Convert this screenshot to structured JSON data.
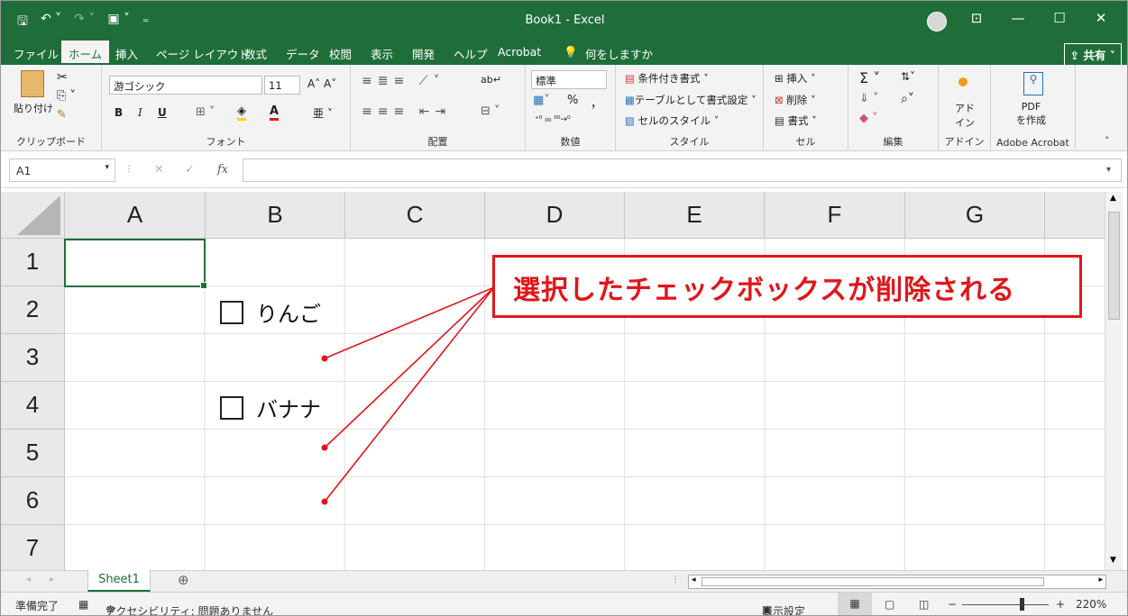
{
  "window": {
    "title": "Book1  -  Excel",
    "controls": [
      "ribbon-display-icon",
      "minimize-icon",
      "maximize-icon",
      "close-icon"
    ],
    "control_glyphs": [
      "⊡",
      "—",
      "☐",
      "✕"
    ]
  },
  "qat": {
    "save_glyph": "🖫",
    "undo_glyph": "↶ ˅",
    "redo_glyph": "↷ ˅",
    "print_glyph": "▣ ˅",
    "more_glyph": "₌"
  },
  "tabs": [
    "ファイル",
    "ホーム",
    "挿入",
    "ページ レイアウト",
    "数式",
    "データ",
    "校閲",
    "表示",
    "開発",
    "ヘルプ",
    "Acrobat",
    "何をしますか"
  ],
  "share_label": "共有",
  "ribbon": {
    "clipboard": {
      "paste_label": "貼り付け",
      "group_label": "クリップボード"
    },
    "font": {
      "font_name": "游ゴシック",
      "font_size": "11",
      "bold": "B",
      "italic": "I",
      "underline": "U",
      "group_label": "フォント"
    },
    "alignment": {
      "group_label": "配置"
    },
    "number": {
      "format": "標準",
      "percent": "%",
      "comma": "，",
      "group_label": "数値"
    },
    "styles": {
      "conditional": "条件付き書式",
      "as_table": "テーブルとして書式設定",
      "cell_styles": "セルのスタイル",
      "group_label": "スタイル"
    },
    "cells": {
      "insert": "挿入",
      "delete": "削除",
      "format": "書式",
      "group_label": "セル"
    },
    "editing": {
      "group_label": "編集"
    },
    "addins": {
      "label": "アド\nイン",
      "group_label": "アドイン"
    },
    "acrobat": {
      "label": "PDF\nを作成",
      "group_label": "Adobe Acrobat"
    }
  },
  "formula_bar": {
    "name_box": "A1",
    "fx": "fx",
    "cancel": "✕",
    "confirm": "✓",
    "value": ""
  },
  "columns": [
    "A",
    "B",
    "C",
    "D",
    "E",
    "F",
    "G"
  ],
  "rows": [
    "1",
    "2",
    "3",
    "4",
    "5",
    "6",
    "7"
  ],
  "checkboxes": [
    {
      "row": "2",
      "label": "りんご",
      "checked": false
    },
    {
      "row": "4",
      "label": "バナナ",
      "checked": false
    }
  ],
  "callout": {
    "text": "選択したチェックボックスが削除される",
    "color": "#e0161a"
  },
  "sheet_tabs": [
    "Sheet1"
  ],
  "add_sheet_glyph": "⊕",
  "status": {
    "ready": "準備完了",
    "accessibility": "アクセシビリティ: 問題ありません",
    "display_settings": "表示設定",
    "zoom": "220%",
    "zoom_minus": "−",
    "zoom_plus": "+"
  },
  "colors": {
    "brand": "#1f6e3a",
    "accent": "#e0161a"
  }
}
